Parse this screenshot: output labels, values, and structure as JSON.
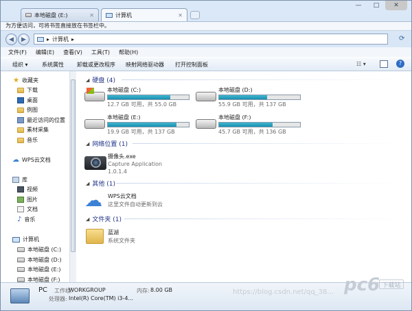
{
  "tabs": [
    {
      "label": "本地磁盘 (E:)",
      "active": false
    },
    {
      "label": "计算机",
      "active": true
    }
  ],
  "window_controls": [
    "—",
    "□",
    "✕"
  ],
  "favbar_text": "为方便访问，可将书签直接放在书签栏中。",
  "address": {
    "path": "计算机",
    "separator": "▸"
  },
  "menu": [
    "文件(F)",
    "编辑(E)",
    "查看(V)",
    "工具(T)",
    "帮助(H)"
  ],
  "commands": [
    "组织 ▾",
    "系统属性",
    "卸载或更改程序",
    "映射网络驱动器",
    "打开控制面板"
  ],
  "sidebar": {
    "favorites": {
      "label": "收藏夹",
      "items": [
        "下载",
        "桌面",
        "例图",
        "最近访问的位置",
        "素材采集",
        "音乐"
      ]
    },
    "wps": "WPS云文档",
    "library": {
      "label": "库",
      "items": [
        "视频",
        "图片",
        "文档",
        "音乐"
      ]
    },
    "computer": {
      "label": "计算机",
      "items": [
        "本地磁盘 (C:)",
        "本地磁盘 (D:)",
        "本地磁盘 (E:)",
        "本地磁盘 (F:)"
      ]
    }
  },
  "groups": {
    "hdd": "硬盘 (4)",
    "network": "网络位置 (1)",
    "other": "其他 (1)",
    "folders": "文件夹 (1)"
  },
  "drives": [
    {
      "name": "本地磁盘 (C:)",
      "info": "12.7 GB 可用，共 55.0 GB",
      "used_fraction": 0.77,
      "system": true
    },
    {
      "name": "本地磁盘 (D:)",
      "info": "55.9 GB 可用，共 137 GB",
      "used_fraction": 0.59,
      "system": false
    },
    {
      "name": "本地磁盘 (E:)",
      "info": "19.9 GB 可用，共 137 GB",
      "used_fraction": 0.85,
      "system": false
    },
    {
      "name": "本地磁盘 (F:)",
      "info": "45.7 GB 可用，共 136 GB",
      "used_fraction": 0.66,
      "system": false
    }
  ],
  "network_item": {
    "name": "摄像头.exe",
    "desc": "Capture Application",
    "version": "1.0.1.4"
  },
  "other_item": {
    "name": "WPS云文档",
    "desc": "这里文件自动更新到云"
  },
  "folder_item": {
    "name": "蓝湖",
    "desc": "系统文件夹"
  },
  "status": {
    "pc": "PC",
    "workgroup_label": "工作组:",
    "workgroup": "WORKGROUP",
    "memory_label": "内存:",
    "memory": "8.00 GB",
    "cpu_label": "处理器:",
    "cpu": "Intel(R) Core(TM) i3-4..."
  },
  "watermark": "https://blog.csdn.net/qq_38...",
  "logo": "pc6",
  "logo_sub": "下载站",
  "colors": {
    "drive_fill": "#1a8fb0",
    "group_title": "#1e3287"
  }
}
